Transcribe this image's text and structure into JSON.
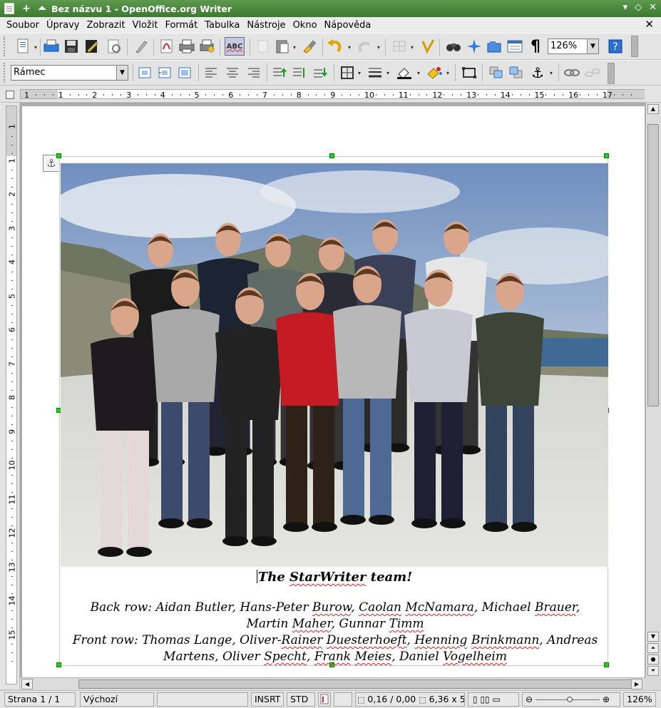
{
  "window": {
    "title": "Bez názvu 1 - OpenOffice.org Writer",
    "icon": "document-icon"
  },
  "menu": [
    "Soubor",
    "Úpravy",
    "Zobrazit",
    "Vložit",
    "Formát",
    "Tabulka",
    "Nástroje",
    "Okno",
    "Nápověda"
  ],
  "toolbar": {
    "zoom_value": "126%",
    "paragraph_style": "Rámec",
    "spellcheck_label": "ABC"
  },
  "ruler": {
    "h_numbers": [
      "1",
      "1",
      "2",
      "3",
      "4",
      "5",
      "6",
      "7",
      "8",
      "9",
      "10",
      "11",
      "12",
      "13",
      "14",
      "15",
      "16",
      "17"
    ],
    "v_numbers": [
      "1",
      "1",
      "2",
      "3",
      "4",
      "5",
      "6",
      "7",
      "8",
      "9",
      "10",
      "11",
      "12",
      "13",
      "14",
      "15"
    ]
  },
  "document": {
    "caption_title": "The StarWriter team!",
    "caption_title_parts": [
      "The ",
      "StarWriter",
      " team!"
    ],
    "back_row_parts": [
      "Back row: Aidan Butler, Hans-Peter ",
      "Burow",
      ", ",
      "Caolan",
      " ",
      "McNamara",
      ", Michael ",
      "Brauer",
      ", Martin ",
      "Maher",
      ", Gunnar ",
      "Timm"
    ],
    "front_row_parts": [
      "Front row: Thomas Lange, Oliver-",
      "Rainer",
      " ",
      "Duesterhoeft",
      ", ",
      "Henning",
      " ",
      "Brinkmann",
      ", Andreas Martens, Oliver ",
      "Specht",
      ", ",
      "Frank",
      " ",
      "Meies",
      ", Daniel ",
      "Vogelheim"
    ]
  },
  "status": {
    "page": "Strana 1 / 1",
    "page_style": "Výchozí",
    "insert_mode": "INSRT",
    "selection_mode": "STD",
    "position": "0,16 / 0,00",
    "size": "6,36 x 5",
    "zoom": "126%"
  },
  "colors": {
    "title_bar": "#4b8a3f",
    "handle": "#1fd31a",
    "spell_underline": "#e02020"
  }
}
